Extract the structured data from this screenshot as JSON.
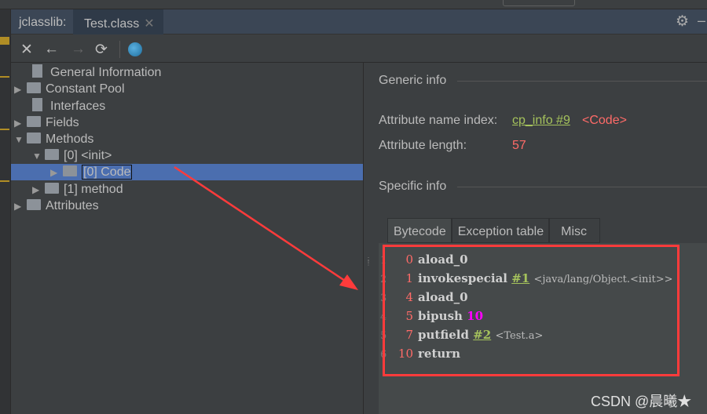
{
  "window": {
    "tool_label": "jclasslib:",
    "file_tab": "Test.class",
    "close_glyph": "✕"
  },
  "toolbar": {
    "close": "✕",
    "back": "←",
    "forward": "→",
    "refresh": "⟳",
    "web": "web-icon"
  },
  "tree": [
    {
      "label": "General Information",
      "type": "doc"
    },
    {
      "label": "Constant Pool",
      "type": "folder",
      "expanded": false
    },
    {
      "label": "Interfaces",
      "type": "doc"
    },
    {
      "label": "Fields",
      "type": "folder",
      "expanded": false
    },
    {
      "label": "Methods",
      "type": "folder",
      "expanded": true
    },
    {
      "label": "[0] <init>",
      "type": "folder",
      "expanded": true
    },
    {
      "label": "[0] Code",
      "type": "folder",
      "expanded": false,
      "selected": true
    },
    {
      "label": "[1] method",
      "type": "folder",
      "expanded": false
    },
    {
      "label": "Attributes",
      "type": "folder",
      "expanded": false
    }
  ],
  "generic": {
    "title": "Generic info",
    "name_index_label": "Attribute name index:",
    "name_index_link": "cp_info #9",
    "name_index_value": "<Code>",
    "length_label": "Attribute length:",
    "length_value": "57"
  },
  "specific": {
    "title": "Specific info"
  },
  "tabs": [
    "Bytecode",
    "Exception table",
    "Misc"
  ],
  "bytecode": [
    {
      "line": "1",
      "offset": "0",
      "op": "aload_0"
    },
    {
      "line": "2",
      "offset": "1",
      "op": "invokespecial",
      "ref": "#1",
      "comment": "<java/lang/Object.<init>>"
    },
    {
      "line": "3",
      "offset": "4",
      "op": "aload_0"
    },
    {
      "line": "4",
      "offset": "5",
      "op": "bipush",
      "arg": "10"
    },
    {
      "line": "5",
      "offset": "7",
      "op": "putfield",
      "ref": "#2",
      "comment": "<Test.a>"
    },
    {
      "line": "6",
      "offset": "10",
      "op": "return"
    }
  ],
  "watermark": "CSDN @晨曦★",
  "colors": {
    "selection": "#4b6eaf",
    "link": "#a5c25c",
    "value": "#ff6b68",
    "annotation": "#ff3b3b",
    "number": "#ff00ff"
  }
}
